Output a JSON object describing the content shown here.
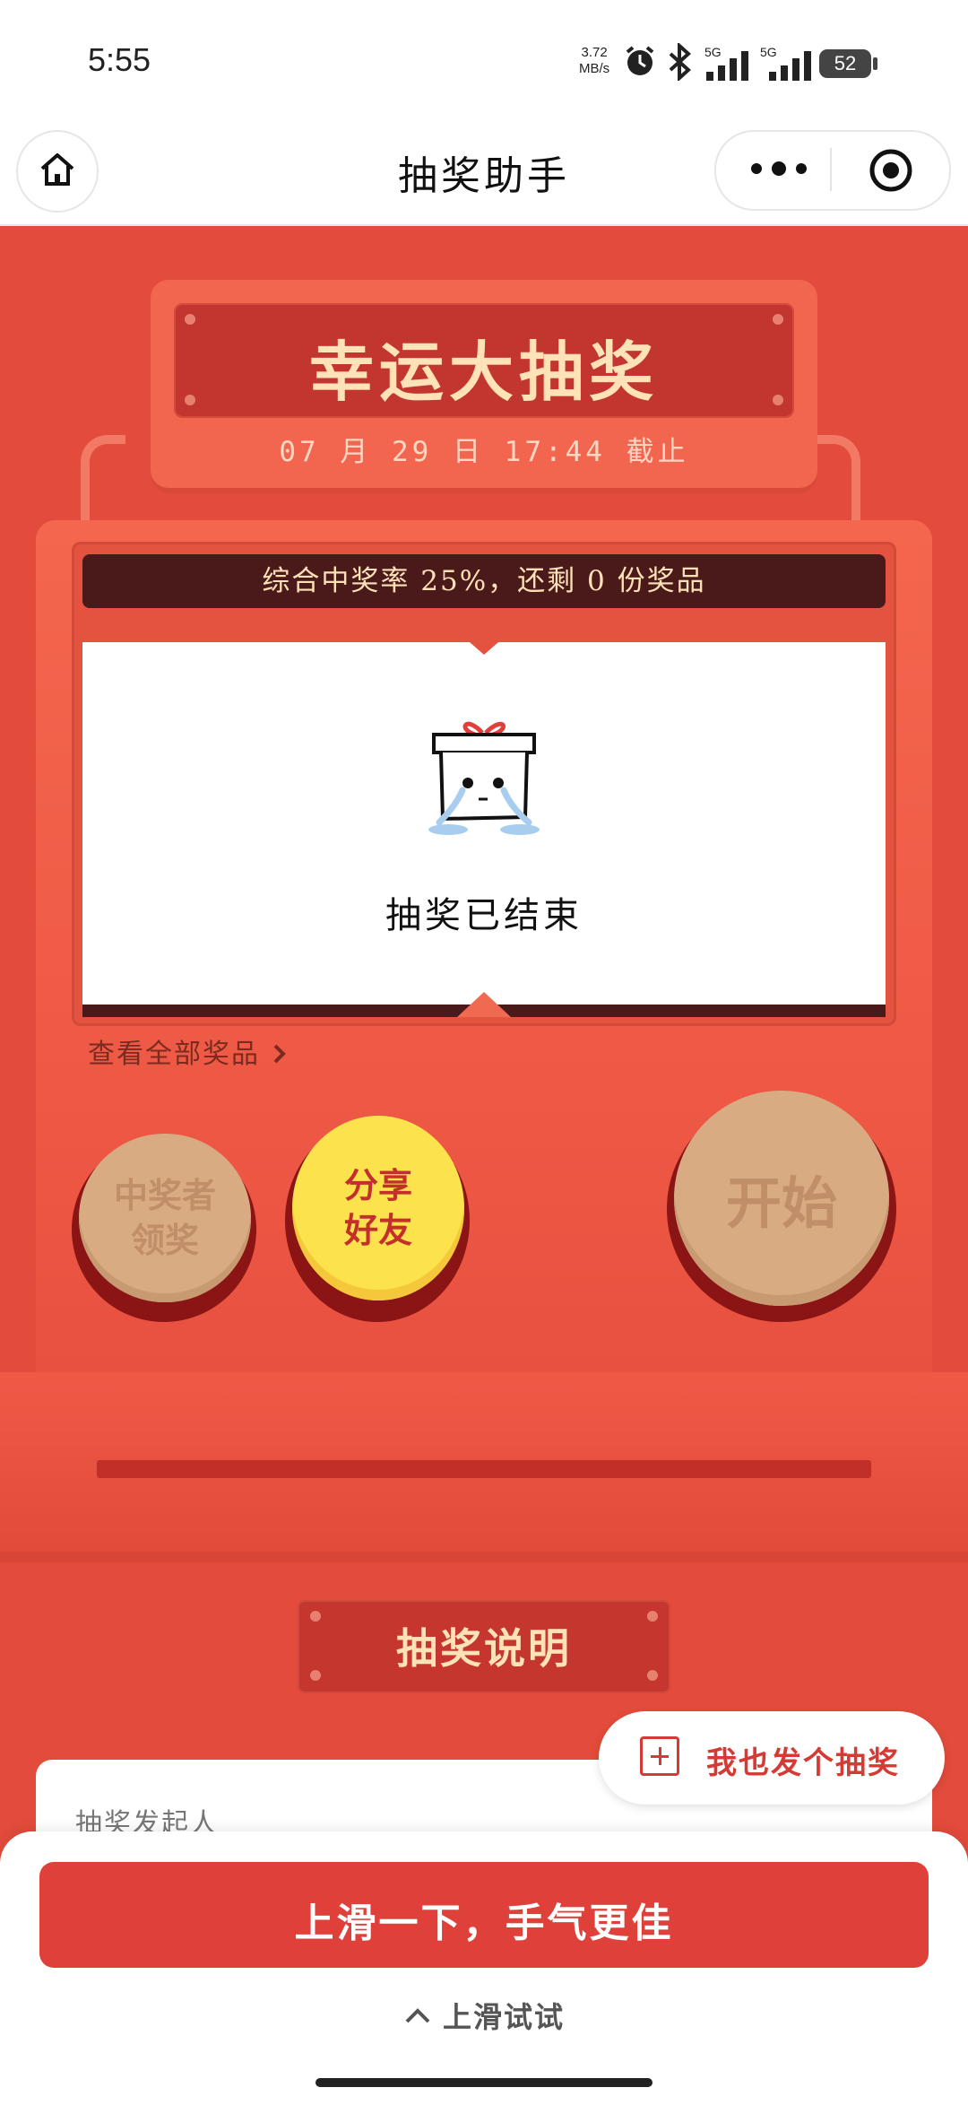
{
  "status_bar": {
    "time": "5:55",
    "net_speed_value": "3.72",
    "net_speed_unit": "MB/s",
    "signal_1": "5G",
    "signal_2": "5G",
    "battery": "52"
  },
  "nav": {
    "title": "抽奖助手",
    "icons": {
      "home": "home-icon",
      "more": "more-icon",
      "close": "target-icon"
    }
  },
  "lottery": {
    "title": "幸运大抽奖",
    "deadline": "07 月 29 日 17:44 截止",
    "ticker": "综合中奖率 25%，还剩 0 份奖品",
    "screen_icon": "crying-gift-box-icon",
    "screen_message": "抽奖已结束",
    "view_all_link": "查看全部奖品",
    "buttons": {
      "claim_line1": "中奖者",
      "claim_line2": "领奖",
      "share_line1": "分享",
      "share_line2": "好友",
      "start": "开始"
    }
  },
  "instructions": {
    "title": "抽奖说明",
    "initiator_label": "抽奖发起人"
  },
  "publish": {
    "label": "我也发个抽奖",
    "icon": "plus-square-icon"
  },
  "bottom_sheet": {
    "swipe_button": "上滑一下，手气更佳",
    "swipe_hint": "上滑试试"
  },
  "colors": {
    "primary_red": "#e34b3c",
    "dark_red": "#c2362f",
    "gold_text": "#ffe2b8",
    "share_yellow": "#fce24c",
    "disabled_tan": "#d9ab82"
  }
}
